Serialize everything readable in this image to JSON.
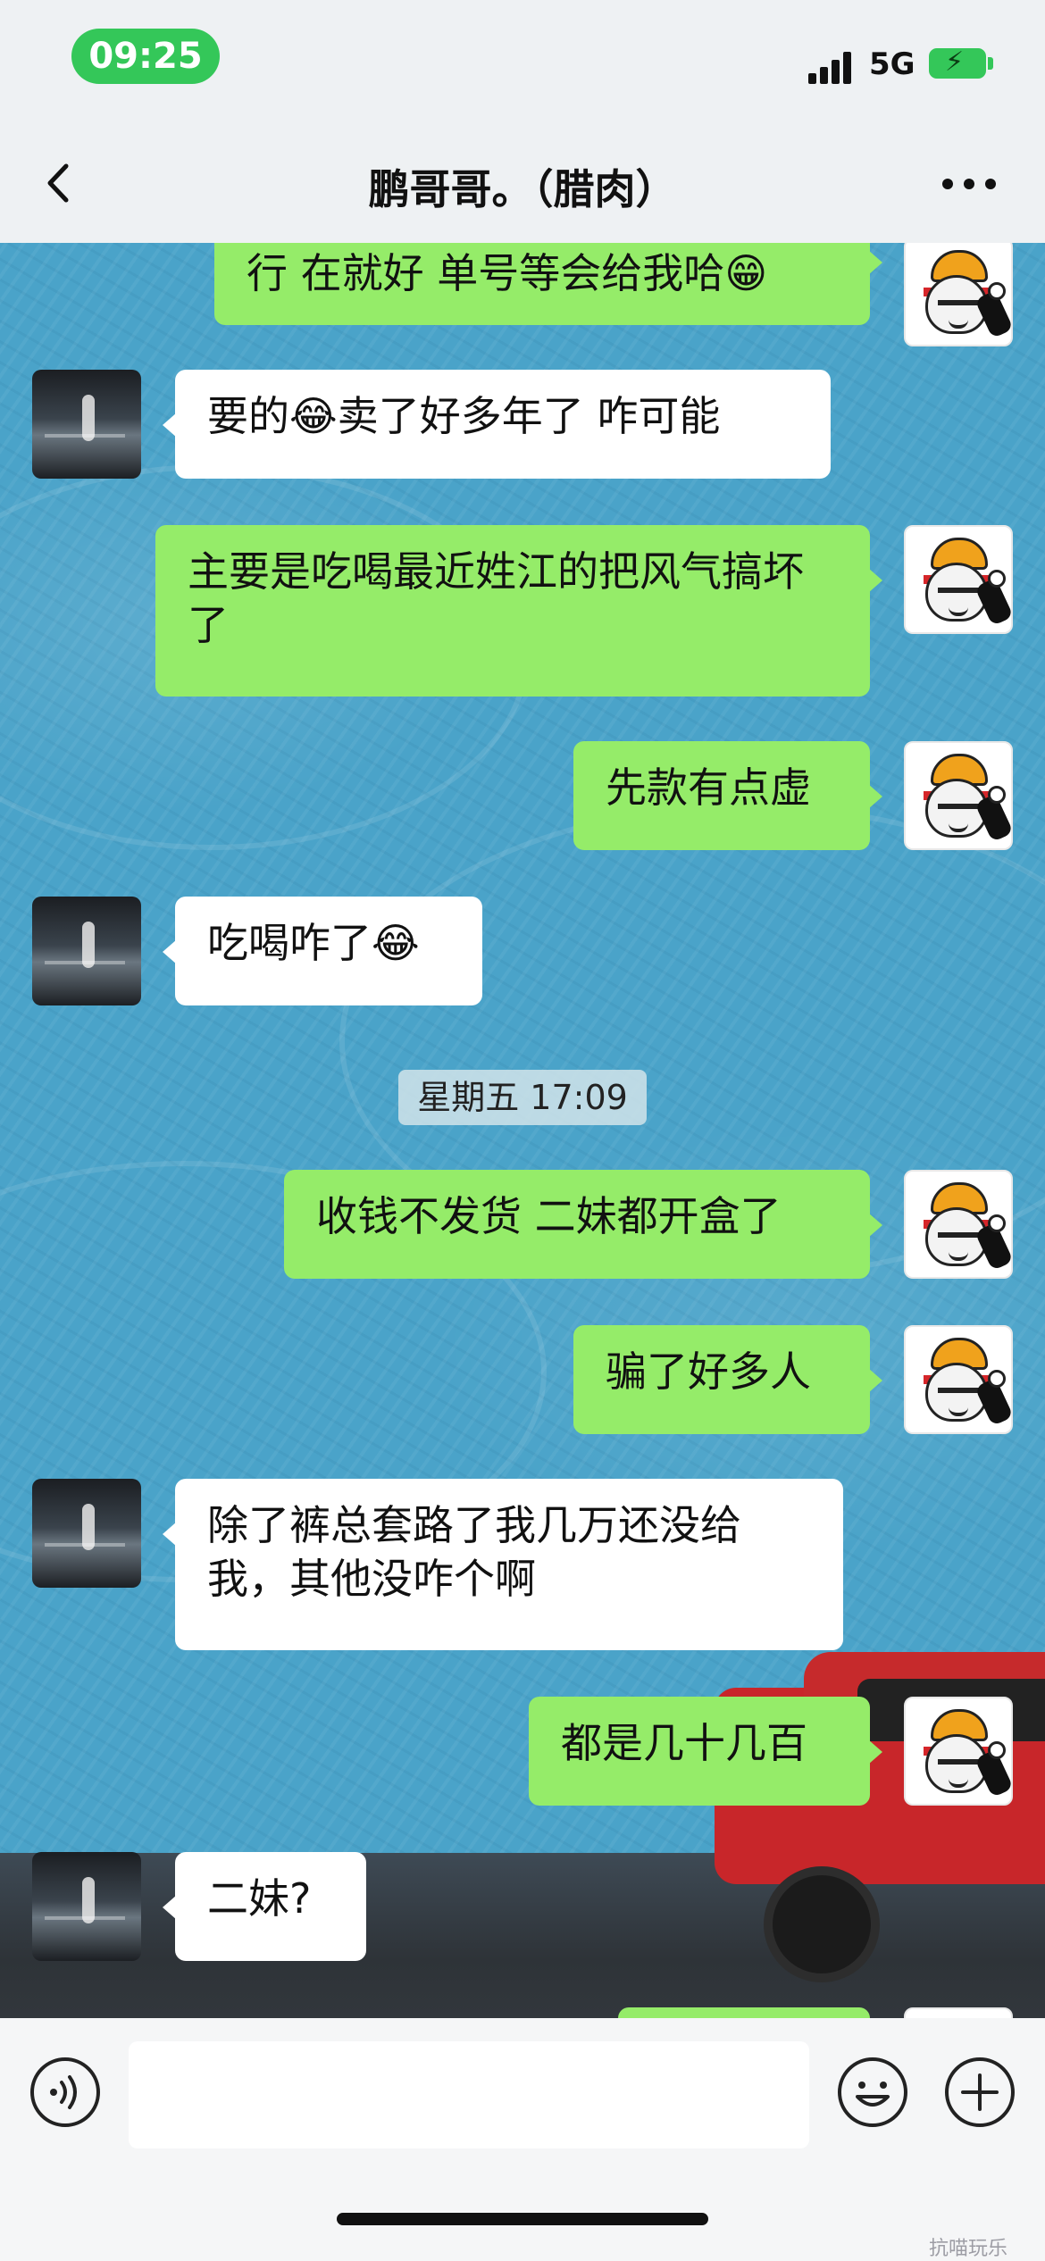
{
  "status_bar": {
    "time": "09:25",
    "network": "5G",
    "battery_state": "charging",
    "accent_color": "#34c759"
  },
  "nav": {
    "title": "鹏哥哥。（腊肉）",
    "back_icon": "chevron-left-icon",
    "more_icon": "more-dots-icon"
  },
  "messages": [
    {
      "side": "out",
      "text": "行 在就好 单号等会给我哈😁"
    },
    {
      "side": "in",
      "text": "要的😂卖了好多年了  咋可能"
    },
    {
      "side": "out",
      "text": "主要是吃喝最近姓江的把风气搞坏了"
    },
    {
      "side": "out",
      "text": "先款有点虚"
    },
    {
      "side": "in",
      "text": "吃喝咋了😂"
    },
    {
      "side": "out",
      "text": "收钱不发货 二妹都开盒了"
    },
    {
      "side": "out",
      "text": "骗了好多人"
    },
    {
      "side": "in",
      "text": "除了裤总套路了我几万还没给我，其他没咋个啊"
    },
    {
      "side": "out",
      "text": "都是几十几百"
    },
    {
      "side": "in",
      "text": "二妹?"
    }
  ],
  "timestamp": "星期五 17:09",
  "input_bar": {
    "voice_icon": "voice-icon",
    "emoji_icon": "emoji-icon",
    "plus_icon": "plus-icon",
    "input_value": ""
  },
  "colors": {
    "outgoing_bubble": "#95ec69",
    "incoming_bubble": "#ffffff",
    "bar_background": "#eef1f3"
  },
  "watermark": "抗喵玩乐"
}
